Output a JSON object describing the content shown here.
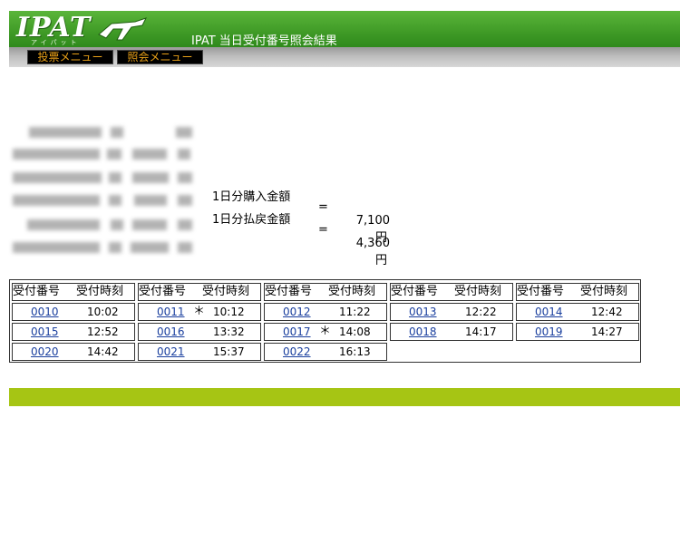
{
  "header": {
    "logo_text": "IPAT",
    "logo_sub": "アイパット",
    "page_title": "IPAT  当日受付番号照会結果",
    "colors": {
      "bar": "#3f9a26",
      "footer": "#a6c514",
      "nav_text": "#e8a018"
    }
  },
  "nav": {
    "vote_menu": "投票メニュー",
    "inquiry_menu": "照会メニュー"
  },
  "amounts": {
    "purchase": {
      "label": "1日分購入金額",
      "eq": "=",
      "value": "7,100",
      "unit": "円"
    },
    "refund": {
      "label": "1日分払戻金額",
      "eq": "=",
      "value": "4,360",
      "unit": "円"
    }
  },
  "table": {
    "header_number": "受付番号",
    "header_time": "受付時刻",
    "entries": [
      {
        "number": "0010",
        "mark": "",
        "time": "10:02"
      },
      {
        "number": "0011",
        "mark": "＊",
        "time": "10:12"
      },
      {
        "number": "0012",
        "mark": "",
        "time": "11:22"
      },
      {
        "number": "0013",
        "mark": "",
        "time": "12:22"
      },
      {
        "number": "0014",
        "mark": "",
        "time": "12:42"
      },
      {
        "number": "0015",
        "mark": "",
        "time": "12:52"
      },
      {
        "number": "0016",
        "mark": "",
        "time": "13:32"
      },
      {
        "number": "0017",
        "mark": "＊",
        "time": "14:08"
      },
      {
        "number": "0018",
        "mark": "",
        "time": "14:17"
      },
      {
        "number": "0019",
        "mark": "",
        "time": "14:27"
      },
      {
        "number": "0020",
        "mark": "",
        "time": "14:42"
      },
      {
        "number": "0021",
        "mark": "",
        "time": "15:37"
      },
      {
        "number": "0022",
        "mark": "",
        "time": "16:13"
      }
    ]
  }
}
